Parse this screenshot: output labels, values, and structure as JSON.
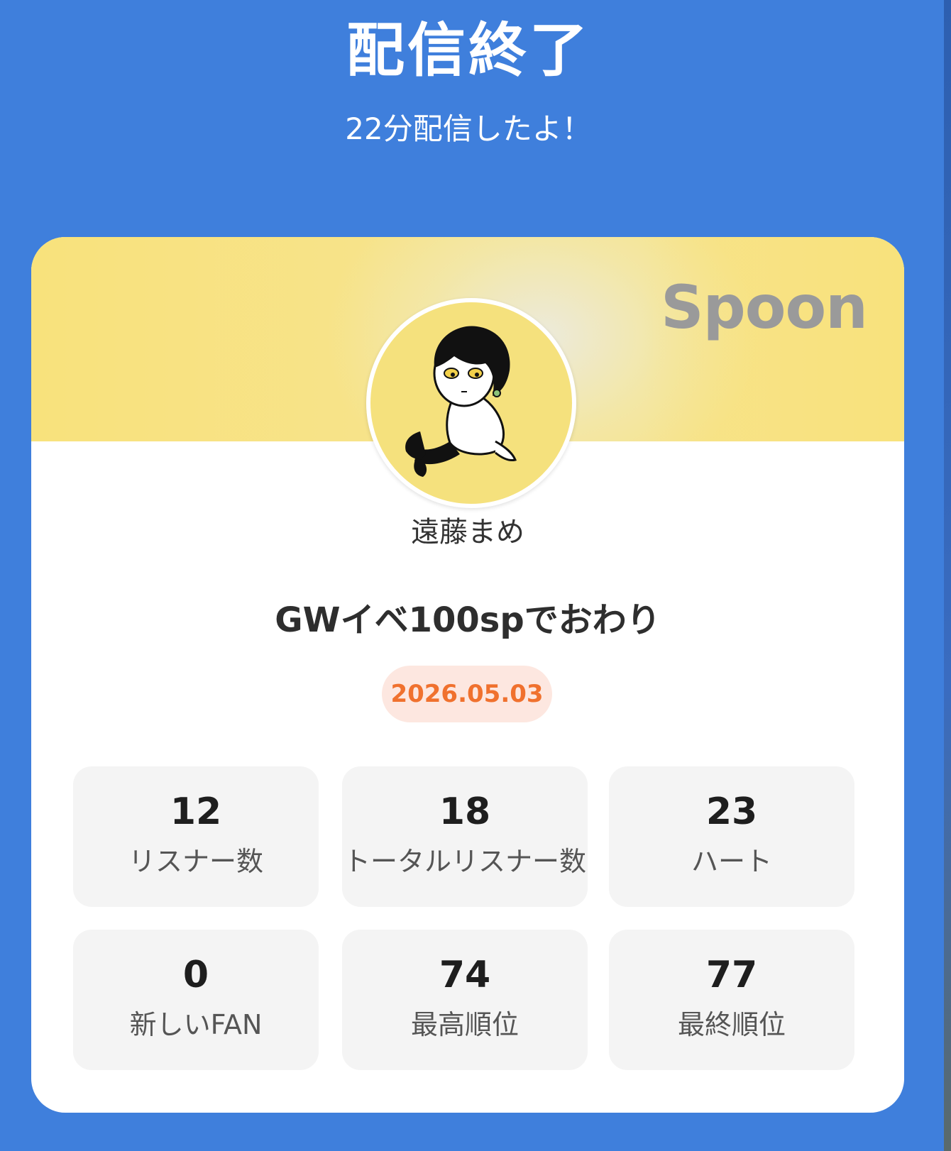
{
  "header": {
    "title": "配信終了",
    "subtitle": "22分配信したよ！"
  },
  "card": {
    "brand": "Spoon",
    "username": "遠藤まめ",
    "live_title": "GWイベ100spでおわり",
    "date": "2026.05.03",
    "stats": [
      {
        "value": "12",
        "label": "リスナー数"
      },
      {
        "value": "18",
        "label": "トータルリスナー数"
      },
      {
        "value": "23",
        "label": "ハート"
      },
      {
        "value": "0",
        "label": "新しいFAN"
      },
      {
        "value": "74",
        "label": "最高順位"
      },
      {
        "value": "77",
        "label": "最終順位"
      }
    ]
  },
  "colors": {
    "background": "#3f7fdc",
    "banner": "#f7e38a",
    "date_text": "#f0712e",
    "date_bg": "#fde7e0",
    "stat_bg": "#f4f4f4"
  }
}
